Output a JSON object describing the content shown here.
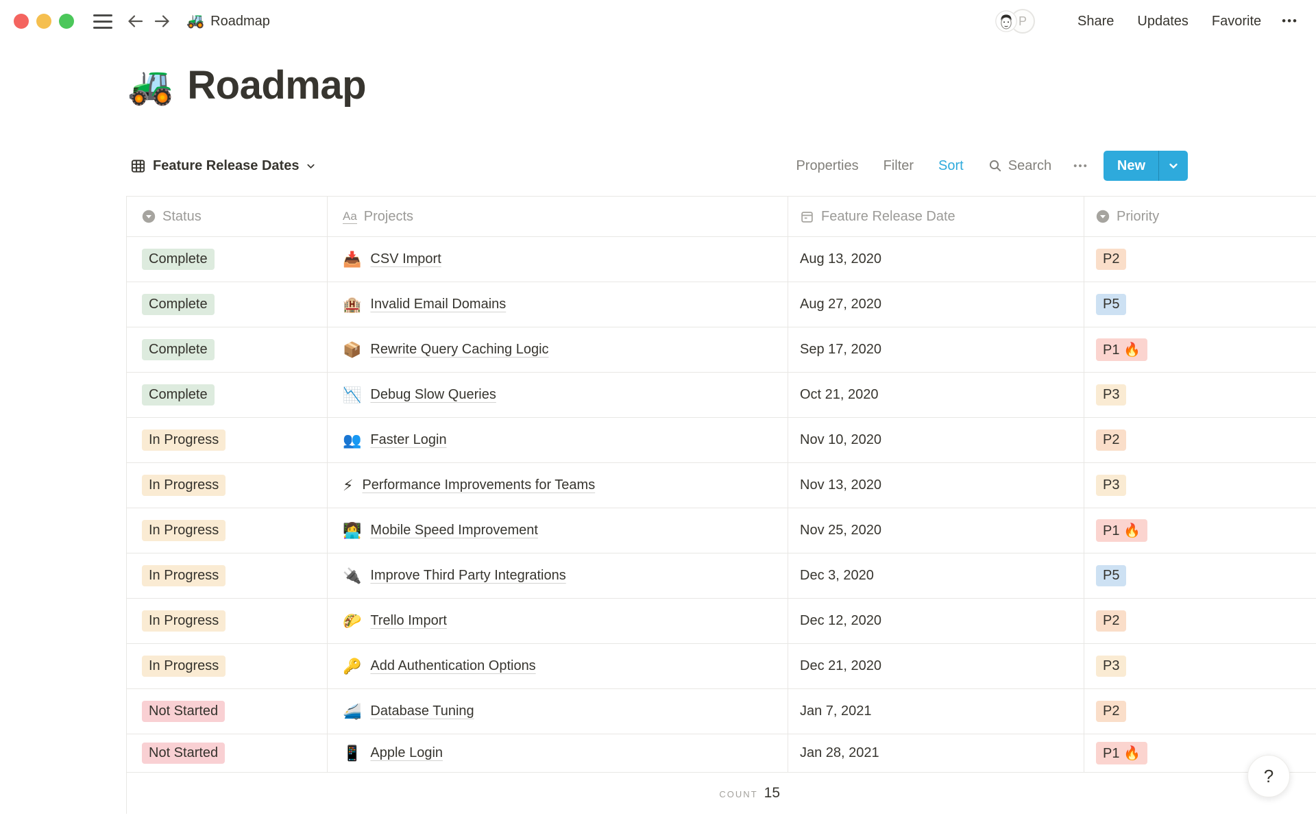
{
  "topbar": {
    "breadcrumb_icon": "🚜",
    "breadcrumb": "Roadmap",
    "avatar_initial": "P",
    "share": "Share",
    "updates": "Updates",
    "favorite": "Favorite",
    "more": "•••"
  },
  "page": {
    "icon": "🚜",
    "title": "Roadmap"
  },
  "view": {
    "name": "Feature Release Dates"
  },
  "toolbar": {
    "properties": "Properties",
    "filter": "Filter",
    "sort": "Sort",
    "search": "Search",
    "more": "•••",
    "new_label": "New"
  },
  "table": {
    "columns": [
      {
        "label": "Status",
        "type": "select"
      },
      {
        "label": "Projects",
        "type": "title"
      },
      {
        "label": "Feature Release Date",
        "type": "date"
      },
      {
        "label": "Priority",
        "type": "select"
      }
    ],
    "rows": [
      {
        "status": "Complete",
        "icon": "📥",
        "project": "CSV Import",
        "date": "Aug 13, 2020",
        "priority": "P2",
        "priority_color": "peach"
      },
      {
        "status": "Complete",
        "icon": "🏨",
        "project": "Invalid Email Domains",
        "date": "Aug 27, 2020",
        "priority": "P5",
        "priority_color": "blue"
      },
      {
        "status": "Complete",
        "icon": "📦",
        "project": "Rewrite Query Caching Logic",
        "date": "Sep 17, 2020",
        "priority": "P1 🔥",
        "priority_color": "red"
      },
      {
        "status": "Complete",
        "icon": "📉",
        "project": "Debug Slow Queries",
        "date": "Oct 21, 2020",
        "priority": "P3",
        "priority_color": "cream"
      },
      {
        "status": "In Progress",
        "icon": "👥",
        "project": "Faster Login",
        "date": "Nov 10, 2020",
        "priority": "P2",
        "priority_color": "peach"
      },
      {
        "status": "In Progress",
        "icon": "⚡",
        "project": "Performance Improvements for Teams",
        "date": "Nov 13, 2020",
        "priority": "P3",
        "priority_color": "cream"
      },
      {
        "status": "In Progress",
        "icon": "👩‍💻",
        "project": "Mobile Speed Improvement",
        "date": "Nov 25, 2020",
        "priority": "P1 🔥",
        "priority_color": "red"
      },
      {
        "status": "In Progress",
        "icon": "🔌",
        "project": "Improve Third Party Integrations",
        "date": "Dec 3, 2020",
        "priority": "P5",
        "priority_color": "blue"
      },
      {
        "status": "In Progress",
        "icon": "🌮",
        "project": "Trello Import",
        "date": "Dec 12, 2020",
        "priority": "P2",
        "priority_color": "peach"
      },
      {
        "status": "In Progress",
        "icon": "🔑",
        "project": "Add Authentication Options",
        "date": "Dec 21, 2020",
        "priority": "P3",
        "priority_color": "cream"
      },
      {
        "status": "Not Started",
        "icon": "🚄",
        "project": "Database Tuning",
        "date": "Jan 7, 2021",
        "priority": "P2",
        "priority_color": "peach"
      },
      {
        "status": "Not Started",
        "icon": "📱",
        "project": "Apple Login",
        "date": "Jan 28, 2021",
        "priority": "P1 🔥",
        "priority_color": "red"
      }
    ],
    "footer": {
      "label": "COUNT",
      "value": "15"
    }
  },
  "help_label": "?",
  "colors": {
    "accent_blue": "#2EAADC",
    "status": {
      "Complete": "#DDEBDE",
      "In Progress": "#FAEBD3",
      "Not Started": "#F9D0D3"
    },
    "priority": {
      "peach": "#FADEC9",
      "blue": "#CDE1F3",
      "red": "#FBD4CF",
      "cream": "#FAEBD3"
    }
  }
}
